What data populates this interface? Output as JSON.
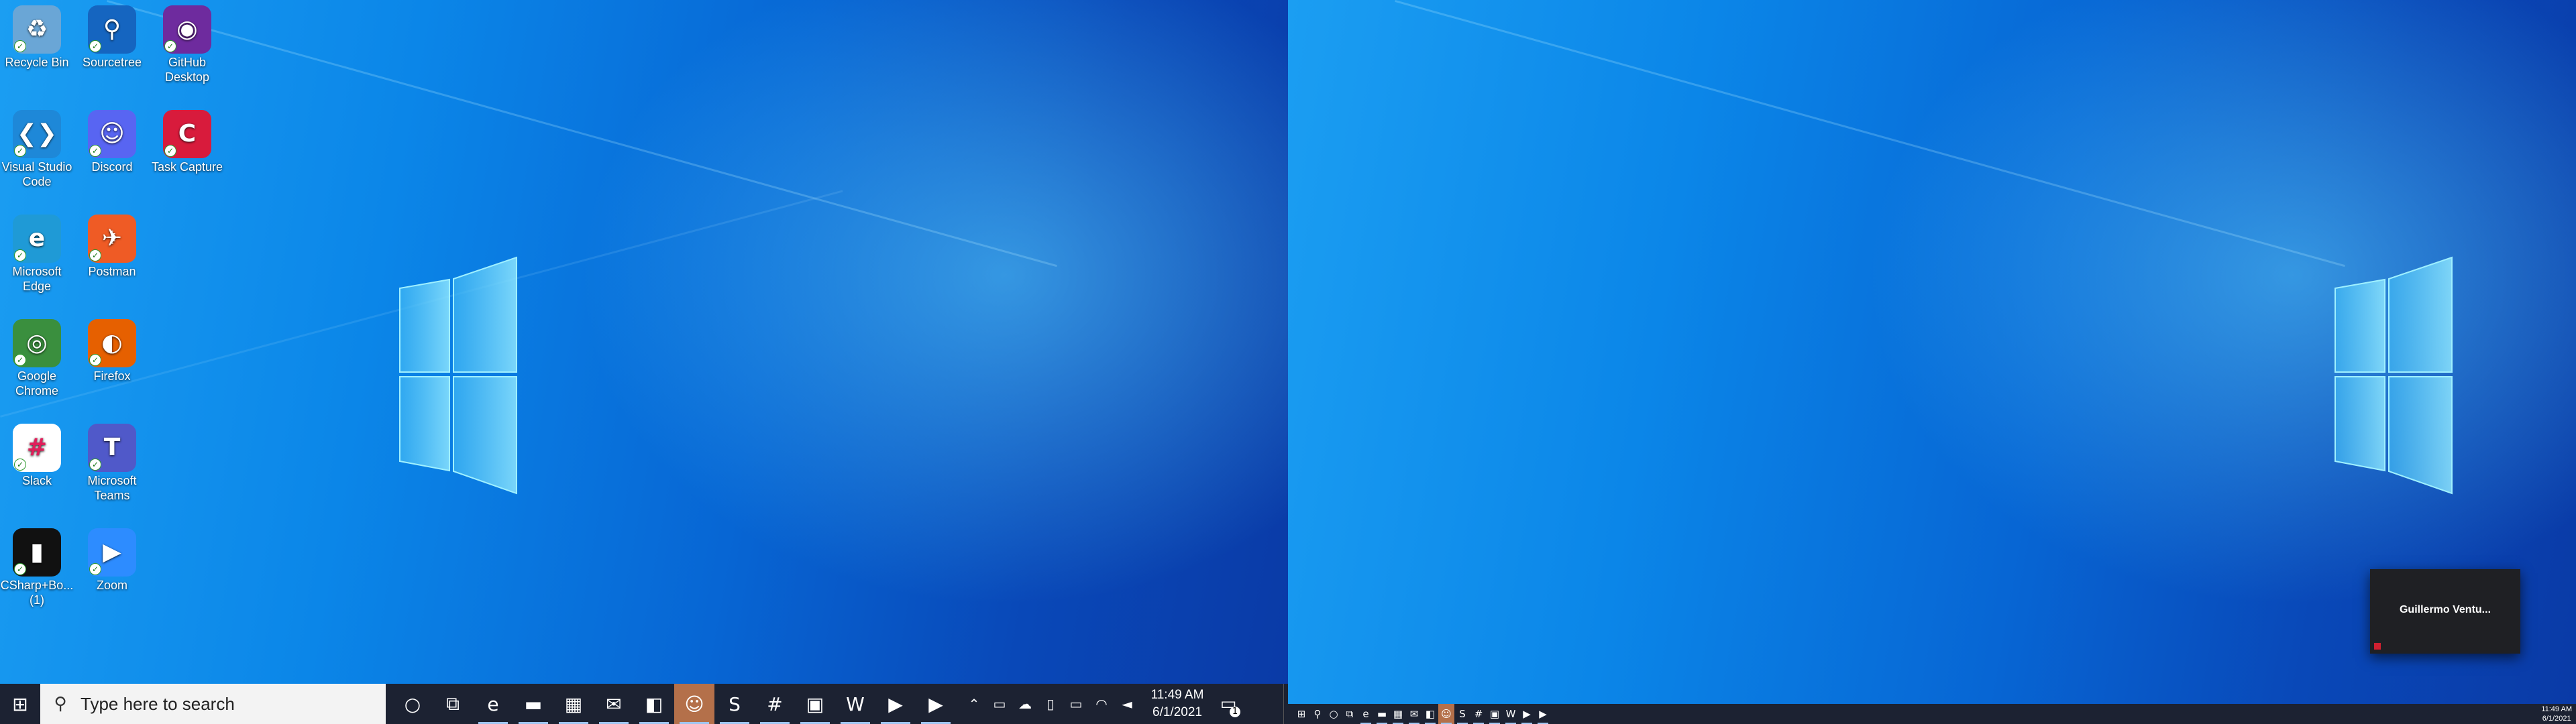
{
  "desktop_icons": [
    {
      "name": "recycle-bin-icon",
      "label": "Recycle Bin",
      "color": "#6aa6d6",
      "glyph": "♻"
    },
    {
      "name": "sourcetree-icon",
      "label": "Sourcetree",
      "color": "#1565c0",
      "glyph": "⚲"
    },
    {
      "name": "github-desktop-icon",
      "label": "GitHub Desktop",
      "color": "#6e2b9e",
      "glyph": "◉"
    },
    {
      "name": "vscode-icon",
      "label": "Visual Studio Code",
      "color": "#1e88d8",
      "glyph": "❮❯"
    },
    {
      "name": "discord-icon",
      "label": "Discord",
      "color": "#5865f2",
      "glyph": "☺"
    },
    {
      "name": "task-capture-icon",
      "label": "Task Capture",
      "color": "#d81b3c",
      "glyph": "C"
    },
    {
      "name": "edge-icon",
      "label": "Microsoft Edge",
      "color": "#1f9ad6",
      "glyph": "e"
    },
    {
      "name": "postman-icon",
      "label": "Postman",
      "color": "#ef5b25",
      "glyph": "✈"
    },
    {
      "name": "chrome-icon",
      "label": "Google Chrome",
      "color": "#3a8f3e",
      "glyph": "◎"
    },
    {
      "name": "firefox-icon",
      "label": "Firefox",
      "color": "#e66000",
      "glyph": "◐"
    },
    {
      "name": "slack-icon",
      "label": "Slack",
      "color": "#ffffff",
      "glyph": "#"
    },
    {
      "name": "teams-icon",
      "label": "Microsoft Teams",
      "color": "#5059c9",
      "glyph": "T"
    },
    {
      "name": "csharp-book-icon",
      "label": "CSharp+Bo... (1)",
      "color": "#111111",
      "glyph": "▮"
    },
    {
      "name": "zoom-icon",
      "label": "Zoom",
      "color": "#2d8cff",
      "glyph": "▶"
    }
  ],
  "taskbar": {
    "search_placeholder": "Type here to search",
    "apps": [
      {
        "name": "cortana-icon",
        "glyph": "○"
      },
      {
        "name": "task-view-icon",
        "glyph": "⧉"
      },
      {
        "name": "edge-taskbar-icon",
        "glyph": "e"
      },
      {
        "name": "file-explorer-icon",
        "glyph": "▬"
      },
      {
        "name": "store-icon",
        "glyph": "▦"
      },
      {
        "name": "mail-icon",
        "glyph": "✉"
      },
      {
        "name": "office-icon",
        "glyph": "◧"
      },
      {
        "name": "discord-taskbar-icon",
        "glyph": "☺"
      },
      {
        "name": "sourcetree-taskbar-icon",
        "glyph": "S"
      },
      {
        "name": "slack-taskbar-icon",
        "glyph": "#"
      },
      {
        "name": "remote-desktop-icon",
        "glyph": "▣"
      },
      {
        "name": "word-icon",
        "glyph": "W"
      },
      {
        "name": "zoom-taskbar-icon",
        "glyph": "▶"
      },
      {
        "name": "camtasia-icon",
        "glyph": "▶"
      }
    ],
    "tray": [
      {
        "name": "chevron-up-icon",
        "glyph": "⌃"
      },
      {
        "name": "meet-now-icon",
        "glyph": "▭"
      },
      {
        "name": "onedrive-icon",
        "glyph": "☁"
      },
      {
        "name": "usb-icon",
        "glyph": "▯"
      },
      {
        "name": "battery-icon",
        "glyph": "▭"
      },
      {
        "name": "wifi-icon",
        "glyph": "◠"
      },
      {
        "name": "volume-icon",
        "glyph": "◄"
      }
    ],
    "time": "11:49 AM",
    "date": "6/1/2021",
    "notification_count": "1"
  },
  "taskbar2": {
    "apps": [
      {
        "name": "start2-icon",
        "glyph": "⊞"
      },
      {
        "name": "search2-icon",
        "glyph": "⚲"
      },
      {
        "name": "cortana2-icon",
        "glyph": "○"
      },
      {
        "name": "task-view2-icon",
        "glyph": "⧉"
      },
      {
        "name": "edge2-icon",
        "glyph": "e"
      },
      {
        "name": "file-explorer2-icon",
        "glyph": "▬"
      },
      {
        "name": "store2-icon",
        "glyph": "▦"
      },
      {
        "name": "mail2-icon",
        "glyph": "✉"
      },
      {
        "name": "office2-icon",
        "glyph": "◧"
      },
      {
        "name": "discord2-icon",
        "glyph": "☺"
      },
      {
        "name": "sourcetree2-icon",
        "glyph": "S"
      },
      {
        "name": "slack2-icon",
        "glyph": "#"
      },
      {
        "name": "remote-desktop2-icon",
        "glyph": "▣"
      },
      {
        "name": "word2-icon",
        "glyph": "W"
      },
      {
        "name": "zoom2-icon",
        "glyph": "▶"
      },
      {
        "name": "camtasia2-icon",
        "glyph": "▶"
      }
    ],
    "time": "11:49 AM",
    "date": "6/1/2021"
  },
  "zoom_popup": {
    "name": "Guillermo  Ventu..."
  }
}
